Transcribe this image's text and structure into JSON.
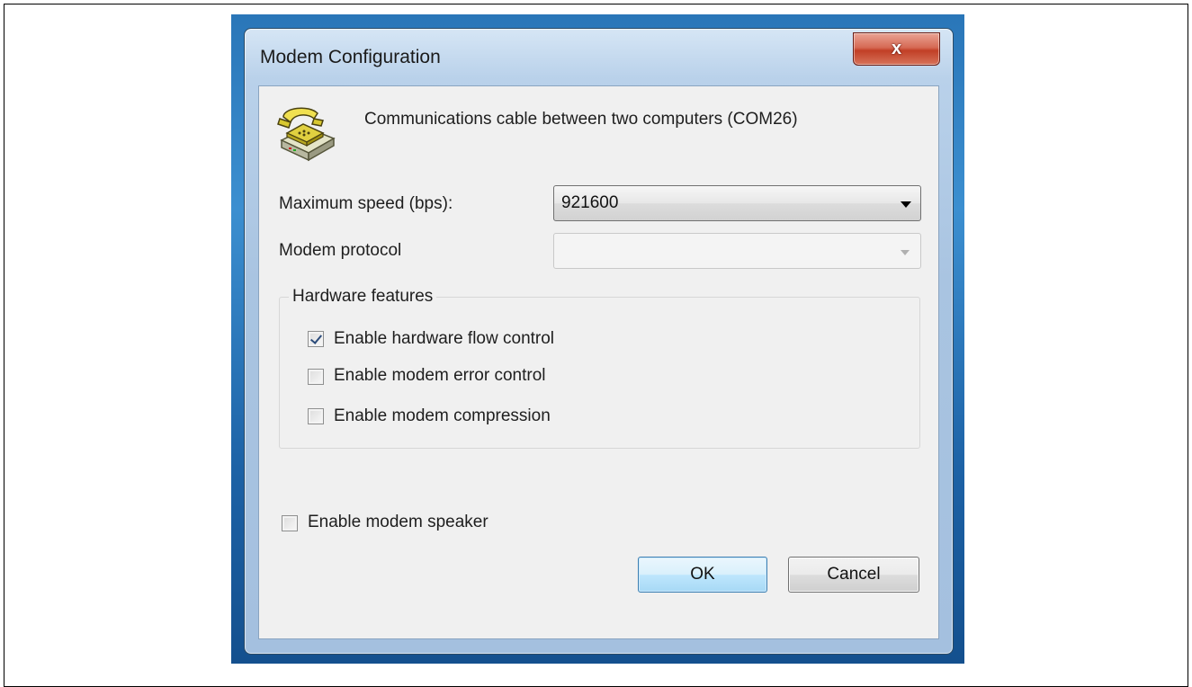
{
  "window": {
    "title": "Modem Configuration",
    "close_glyph": "x"
  },
  "device": {
    "icon": "telephone-icon",
    "name": "Communications cable between two computers (COM26)"
  },
  "speed": {
    "label": "Maximum speed (bps):",
    "value": "921600"
  },
  "protocol": {
    "label": "Modem protocol",
    "value": "",
    "enabled": false
  },
  "hardware": {
    "legend": "Hardware features",
    "options": [
      {
        "label": "Enable hardware flow control",
        "checked": true
      },
      {
        "label": "Enable modem error control",
        "checked": false
      },
      {
        "label": "Enable modem compression",
        "checked": false
      }
    ]
  },
  "speaker": {
    "label": "Enable modem speaker",
    "checked": false
  },
  "buttons": {
    "ok": "OK",
    "cancel": "Cancel"
  }
}
